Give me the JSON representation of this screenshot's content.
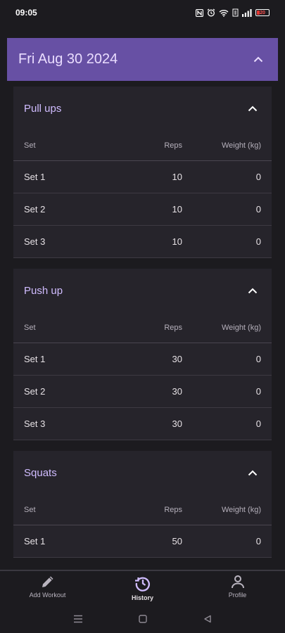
{
  "status_bar": {
    "time": "09:05",
    "battery_level": "20",
    "icons": [
      "nfc-icon",
      "alarm-icon",
      "wifi-icon",
      "volte-icon",
      "signal-icon",
      "battery-icon"
    ]
  },
  "history": {
    "date_label": "Fri Aug 30 2024",
    "table_headers": {
      "set": "Set",
      "reps": "Reps",
      "weight": "Weight (kg)"
    },
    "exercises": [
      {
        "name": "Pull ups",
        "sets": [
          {
            "set": "Set 1",
            "reps": "10",
            "weight": "0"
          },
          {
            "set": "Set 2",
            "reps": "10",
            "weight": "0"
          },
          {
            "set": "Set 3",
            "reps": "10",
            "weight": "0"
          }
        ]
      },
      {
        "name": "Push up",
        "sets": [
          {
            "set": "Set 1",
            "reps": "30",
            "weight": "0"
          },
          {
            "set": "Set 2",
            "reps": "30",
            "weight": "0"
          },
          {
            "set": "Set 3",
            "reps": "30",
            "weight": "0"
          }
        ]
      },
      {
        "name": "Squats",
        "sets": [
          {
            "set": "Set 1",
            "reps": "50",
            "weight": "0"
          }
        ]
      }
    ]
  },
  "bottom_nav": {
    "items": [
      {
        "label": "Add Workout",
        "icon": "pencil-icon",
        "active": false
      },
      {
        "label": "History",
        "icon": "history-icon",
        "active": true
      },
      {
        "label": "Profile",
        "icon": "person-icon",
        "active": false
      }
    ]
  },
  "colors": {
    "background": "#1c1b1f",
    "header_bg": "#6750a4",
    "card_bg": "#26242b",
    "accent_text": "#d0bcff"
  }
}
